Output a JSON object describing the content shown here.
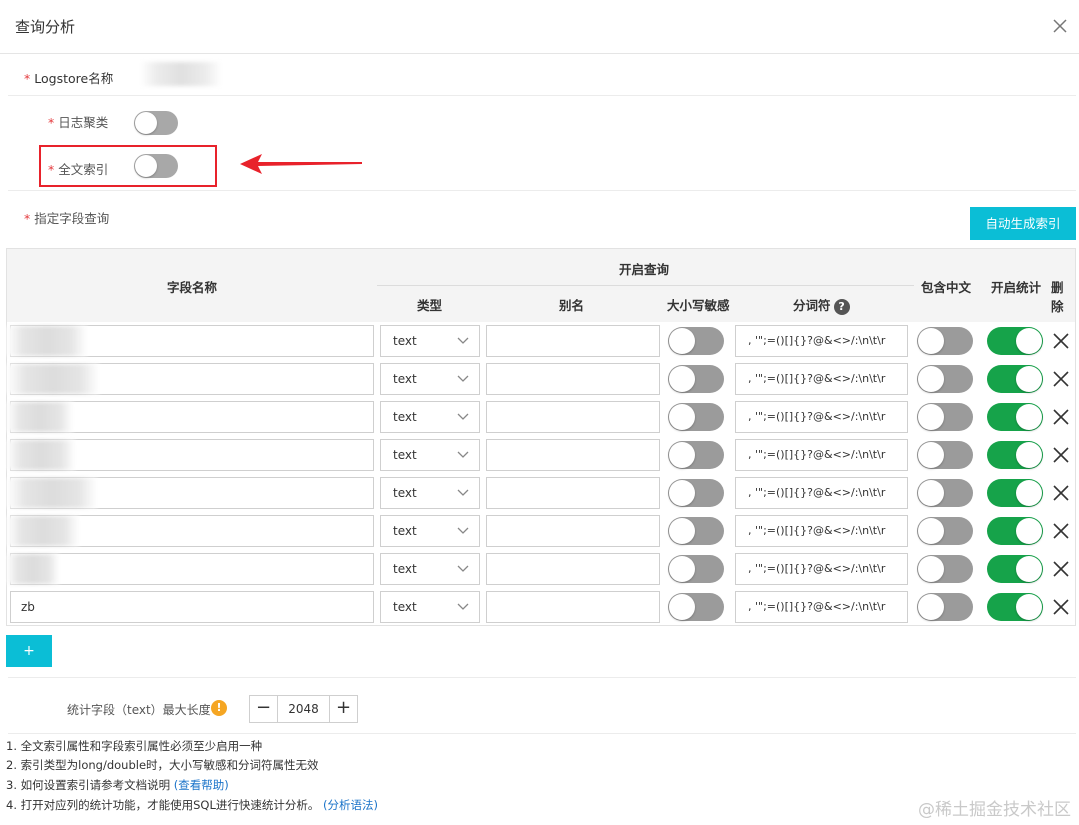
{
  "dialog": {
    "title": "查询分析",
    "close_icon": "close-icon"
  },
  "form": {
    "logstore_label": "Logstore名称",
    "log_cluster_label": "日志聚类",
    "log_cluster_enabled": false,
    "full_text_index_label": "全文索引",
    "full_text_index_enabled": false,
    "field_query_label": "指定字段查询",
    "required_mark": "*"
  },
  "toolbar": {
    "auto_generate_label": "自动生成索引",
    "accent_color": "#0bbed6"
  },
  "table": {
    "headers": {
      "field_name": "字段名称",
      "enable_query": "开启查询",
      "type": "类型",
      "alias": "别名",
      "case_sensitive": "大小写敏感",
      "delimiter": "分词符",
      "contains_chinese": "包含中文",
      "enable_stats": "开启统计",
      "delete": "删除"
    },
    "rows": [
      {
        "name": "",
        "type": "text",
        "alias": "",
        "case_sensitive": false,
        "delimiter": ", '\";=()[]{}?@&<>/:\\n\\t\\r",
        "chinese": false,
        "stats": true
      },
      {
        "name": "",
        "type": "text",
        "alias": "",
        "case_sensitive": false,
        "delimiter": ", '\";=()[]{}?@&<>/:\\n\\t\\r",
        "chinese": false,
        "stats": true
      },
      {
        "name": "",
        "type": "text",
        "alias": "",
        "case_sensitive": false,
        "delimiter": ", '\";=()[]{}?@&<>/:\\n\\t\\r",
        "chinese": false,
        "stats": true
      },
      {
        "name": "",
        "type": "text",
        "alias": "",
        "case_sensitive": false,
        "delimiter": ", '\";=()[]{}?@&<>/:\\n\\t\\r",
        "chinese": false,
        "stats": true
      },
      {
        "name": "",
        "type": "text",
        "alias": "",
        "case_sensitive": false,
        "delimiter": ", '\";=()[]{}?@&<>/:\\n\\t\\r",
        "chinese": false,
        "stats": true
      },
      {
        "name": "",
        "type": "text",
        "alias": "",
        "case_sensitive": false,
        "delimiter": ", '\";=()[]{}?@&<>/:\\n\\t\\r",
        "chinese": false,
        "stats": true
      },
      {
        "name": "",
        "type": "text",
        "alias": "",
        "case_sensitive": false,
        "delimiter": ", '\";=()[]{}?@&<>/:\\n\\t\\r",
        "chinese": false,
        "stats": true
      },
      {
        "name": "zb",
        "type": "text",
        "alias": "",
        "case_sensitive": false,
        "delimiter": ", '\";=()[]{}?@&<>/:\\n\\t\\r",
        "chinese": false,
        "stats": true
      }
    ],
    "add_row_label": "+"
  },
  "stats": {
    "label": "统计字段（text）最大长度",
    "value": "2048",
    "minus": "−",
    "plus": "+"
  },
  "notes": [
    {
      "text": "1. 全文索引属性和字段索引属性必须至少启用一种",
      "link": ""
    },
    {
      "text": "2. 索引类型为long/double时，大小写敏感和分词符属性无效",
      "link": ""
    },
    {
      "text": "3. 如何设置索引请参考文档说明",
      "link": "(查看帮助)"
    },
    {
      "text": "4. 打开对应列的统计功能，才能使用SQL进行快速统计分析。",
      "link": "(分析语法)"
    }
  ],
  "watermark": "@稀土掘金技术社区",
  "colors": {
    "toggle_on": "#16a34a",
    "toggle_off": "#a8a8a8",
    "highlight": "#e8222b"
  }
}
